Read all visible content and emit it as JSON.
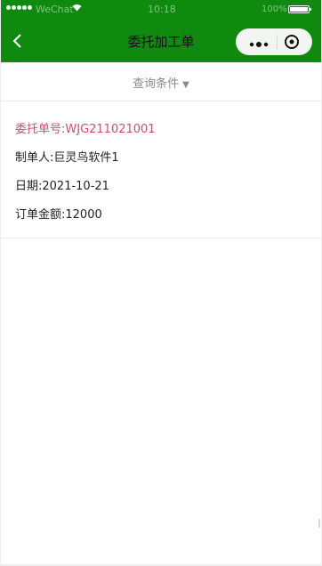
{
  "status_bar": {
    "carrier": "WeChat",
    "time": "10:18",
    "battery": "100%"
  },
  "nav": {
    "title": "委托加工单"
  },
  "query": {
    "label": "查询条件",
    "caret": "▼"
  },
  "order": {
    "order_no": "委托单号:WJG211021001",
    "maker": "制单人:巨灵鸟软件1",
    "date": "日期:2021-10-21",
    "amount": "订单金额:12000"
  },
  "colors": {
    "brand": "#0f8a0f",
    "accent": "#c8506e",
    "muted": "#8a8a8a"
  }
}
